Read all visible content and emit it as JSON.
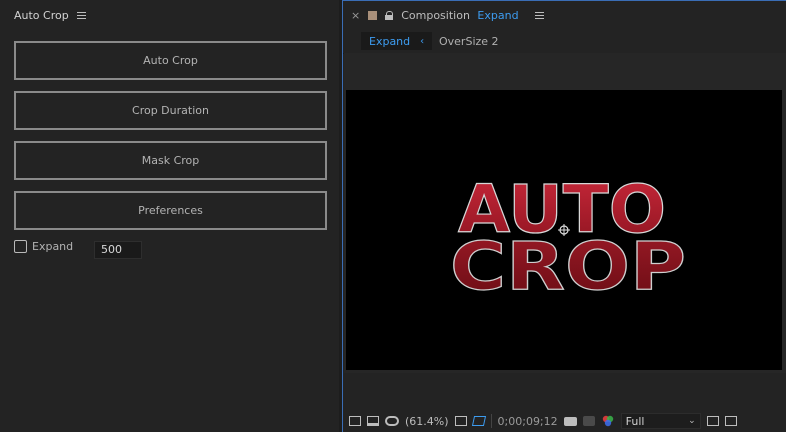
{
  "left_panel": {
    "title": "Auto Crop",
    "buttons": [
      "Auto Crop",
      "Crop Duration",
      "Mask Crop",
      "Preferences"
    ],
    "expand_checkbox": {
      "label": "Expand",
      "checked": false
    },
    "expand_value": "500"
  },
  "right_panel": {
    "close": "×",
    "label": "Composition",
    "comp_name": "Expand",
    "tabs": [
      {
        "label": "Expand",
        "active": true
      },
      {
        "label": "OverSize 2",
        "active": false
      }
    ],
    "viewer_text": {
      "line1": "AUTO",
      "line2": "CROP"
    },
    "bottom_bar": {
      "zoom": "(61.4%)",
      "timecode": "0;00;09;12",
      "resolution": "Full",
      "icons": [
        "layers-icon",
        "monitor-icon",
        "mask-icon",
        "grid-icon",
        "region-icon",
        "camera-icon",
        "snapshot-icon",
        "color-icon",
        "dropdown-icon",
        "view-icon",
        "transparency-icon"
      ]
    }
  },
  "colors": {
    "accent": "#3d9cf0",
    "logo_red": "#b0202c",
    "logo_dark": "#7a1018"
  }
}
